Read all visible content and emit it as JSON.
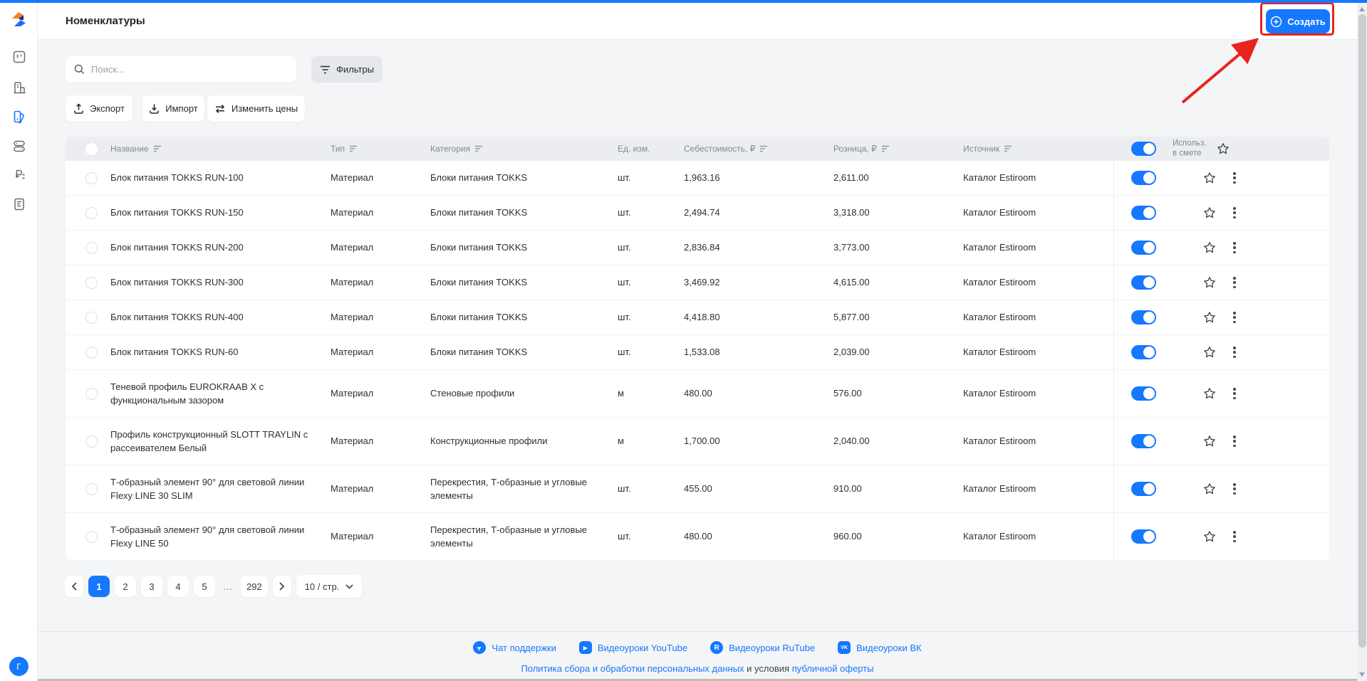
{
  "colors": {
    "primary": "#1677ff",
    "annotation_red": "#e8231e",
    "content_bg": "#f4f5f6",
    "table_header_bg": "#ebedf0"
  },
  "header": {
    "title": "Номенклатуры",
    "create_label": "Создать"
  },
  "sidebar": {
    "avatar_initial": "Г",
    "active_item": "nomenclatures"
  },
  "toolbar": {
    "search_placeholder": "Поиск...",
    "filters_label": "Фильтры",
    "export_label": "Экспорт",
    "import_label": "Импорт",
    "change_prices_label": "Изменить цены"
  },
  "table": {
    "headers": {
      "name": "Название",
      "type": "Тип",
      "category": "Категория",
      "unit": "Ед. изм.",
      "cost": "Себестоимость, ₽",
      "retail": "Розница, ₽",
      "source": "Источник",
      "use_line1": "Использ.",
      "use_line2": "в смете"
    },
    "rows": [
      {
        "name": "Блок питания TOKKS RUN-100",
        "type": "Материал",
        "category": "Блоки питания TOKKS",
        "unit": "шт.",
        "cost": "1,963.16",
        "retail": "2,611.00",
        "source": "Каталог Estiroom",
        "enabled": true
      },
      {
        "name": "Блок питания TOKKS RUN-150",
        "type": "Материал",
        "category": "Блоки питания TOKKS",
        "unit": "шт.",
        "cost": "2,494.74",
        "retail": "3,318.00",
        "source": "Каталог Estiroom",
        "enabled": true
      },
      {
        "name": "Блок питания TOKKS RUN-200",
        "type": "Материал",
        "category": "Блоки питания TOKKS",
        "unit": "шт.",
        "cost": "2,836.84",
        "retail": "3,773.00",
        "source": "Каталог Estiroom",
        "enabled": true
      },
      {
        "name": "Блок питания TOKKS RUN-300",
        "type": "Материал",
        "category": "Блоки питания TOKKS",
        "unit": "шт.",
        "cost": "3,469.92",
        "retail": "4,615.00",
        "source": "Каталог Estiroom",
        "enabled": true
      },
      {
        "name": "Блок питания TOKKS RUN-400",
        "type": "Материал",
        "category": "Блоки питания TOKKS",
        "unit": "шт.",
        "cost": "4,418.80",
        "retail": "5,877.00",
        "source": "Каталог Estiroom",
        "enabled": true
      },
      {
        "name": "Блок питания TOKKS RUN-60",
        "type": "Материал",
        "category": "Блоки питания TOKKS",
        "unit": "шт.",
        "cost": "1,533.08",
        "retail": "2,039.00",
        "source": "Каталог Estiroom",
        "enabled": true
      },
      {
        "name": "Теневой профиль EUROKRAAB X с функциональным зазором",
        "type": "Материал",
        "category": "Стеновые профили",
        "unit": "м",
        "cost": "480.00",
        "retail": "576.00",
        "source": "Каталог Estiroom",
        "enabled": true
      },
      {
        "name": "Профиль конструкционный SLOTT TRAYLIN с рассеивателем Белый",
        "type": "Материал",
        "category": "Конструкционные профили",
        "unit": "м",
        "cost": "1,700.00",
        "retail": "2,040.00",
        "source": "Каталог Estiroom",
        "enabled": true
      },
      {
        "name": "Т-образный элемент 90° для световой линии Flexy LINE 30 SLIM",
        "type": "Материал",
        "category": "Перекрестия, Т-образные и угловые элементы",
        "unit": "шт.",
        "cost": "455.00",
        "retail": "910.00",
        "source": "Каталог Estiroom",
        "enabled": true
      },
      {
        "name": "Т-образный элемент 90° для световой линии Flexy LINE 50",
        "type": "Материал",
        "category": "Перекрестия, Т-образные и угловые элементы",
        "unit": "шт.",
        "cost": "480.00",
        "retail": "960.00",
        "source": "Каталог Estiroom",
        "enabled": true
      }
    ]
  },
  "pagination": {
    "pages": [
      "1",
      "2",
      "3",
      "4",
      "5",
      "…",
      "292"
    ],
    "active_page": "1",
    "page_size_label": "10 / стр."
  },
  "footer": {
    "links": [
      {
        "icon": "telegram-icon",
        "label": "Чат поддержки"
      },
      {
        "icon": "youtube-icon",
        "label": "Видеоуроки YouTube"
      },
      {
        "icon": "rutube-icon",
        "label": "Видеоуроки RuTube"
      },
      {
        "icon": "vk-icon",
        "label": "Видеоуроки ВК"
      }
    ],
    "policy_link": "Политика сбора и обработки персональных данных",
    "between_text": " и условия ",
    "offer_link": "публичной оферты"
  }
}
